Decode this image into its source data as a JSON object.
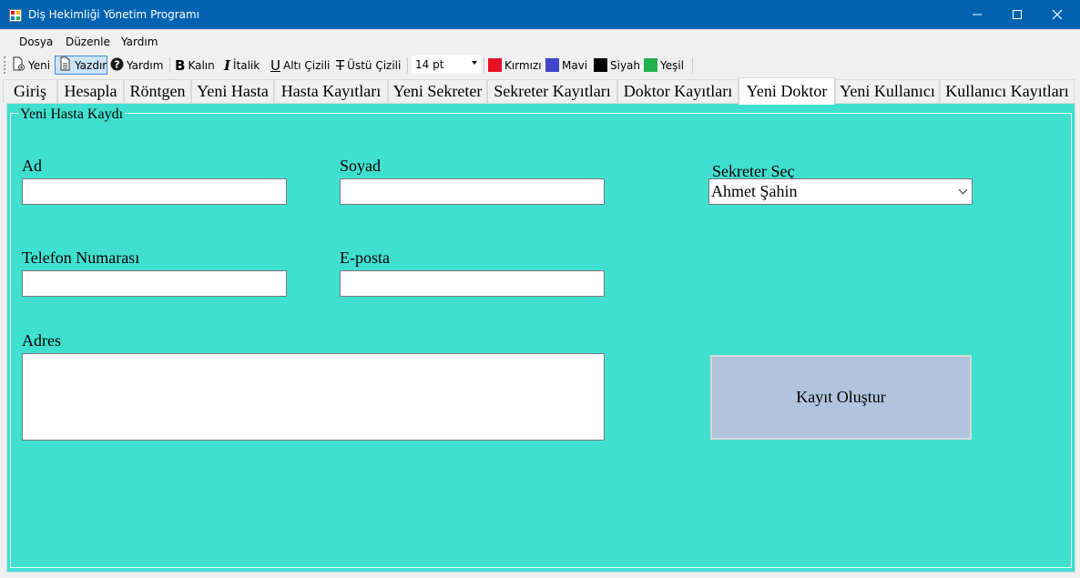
{
  "window": {
    "title": "Diş Hekimliği Yönetim Programı"
  },
  "menu": {
    "file": "Dosya",
    "edit": "Düzenle",
    "help": "Yardım"
  },
  "toolbar": {
    "new_label": "Yeni",
    "print_label": "Yazdır",
    "help_label": "Yardım",
    "bold_label": "Kalın",
    "italic_label": "İtalik",
    "underline_label": "Altı Çizili",
    "strike_label": "Üstü Çizili",
    "font_size": "14 pt",
    "red_label": "Kırmızı",
    "blue_label": "Mavi",
    "black_label": "Siyah",
    "green_label": "Yeşil",
    "colors": {
      "red": "#e81123",
      "blue": "#3f48cc",
      "black": "#000000",
      "green": "#22b14c"
    }
  },
  "tabs": [
    "Giriş",
    "Hesapla",
    "Röntgen",
    "Yeni Hasta",
    "Hasta Kayıtları",
    "Yeni Sekreter",
    "Sekreter Kayıtları",
    "Doktor Kayıtları",
    "Yeni Doktor",
    "Yeni Kullanıcı",
    "Kullanıcı Kayıtları"
  ],
  "selected_tab": "Yeni Doktor",
  "form": {
    "group_title": "Yeni Hasta Kaydı",
    "name_label": "Ad",
    "surname_label": "Soyad",
    "phone_label": "Telefon Numarası",
    "email_label": "E-posta",
    "address_label": "Adres",
    "secretary_label": "Sekreter Seç",
    "secretary_value": "Ahmet Şahin",
    "submit_label": "Kayıt Oluştur",
    "background_color": "#40e0d0",
    "button_color": "#b0c4de"
  }
}
